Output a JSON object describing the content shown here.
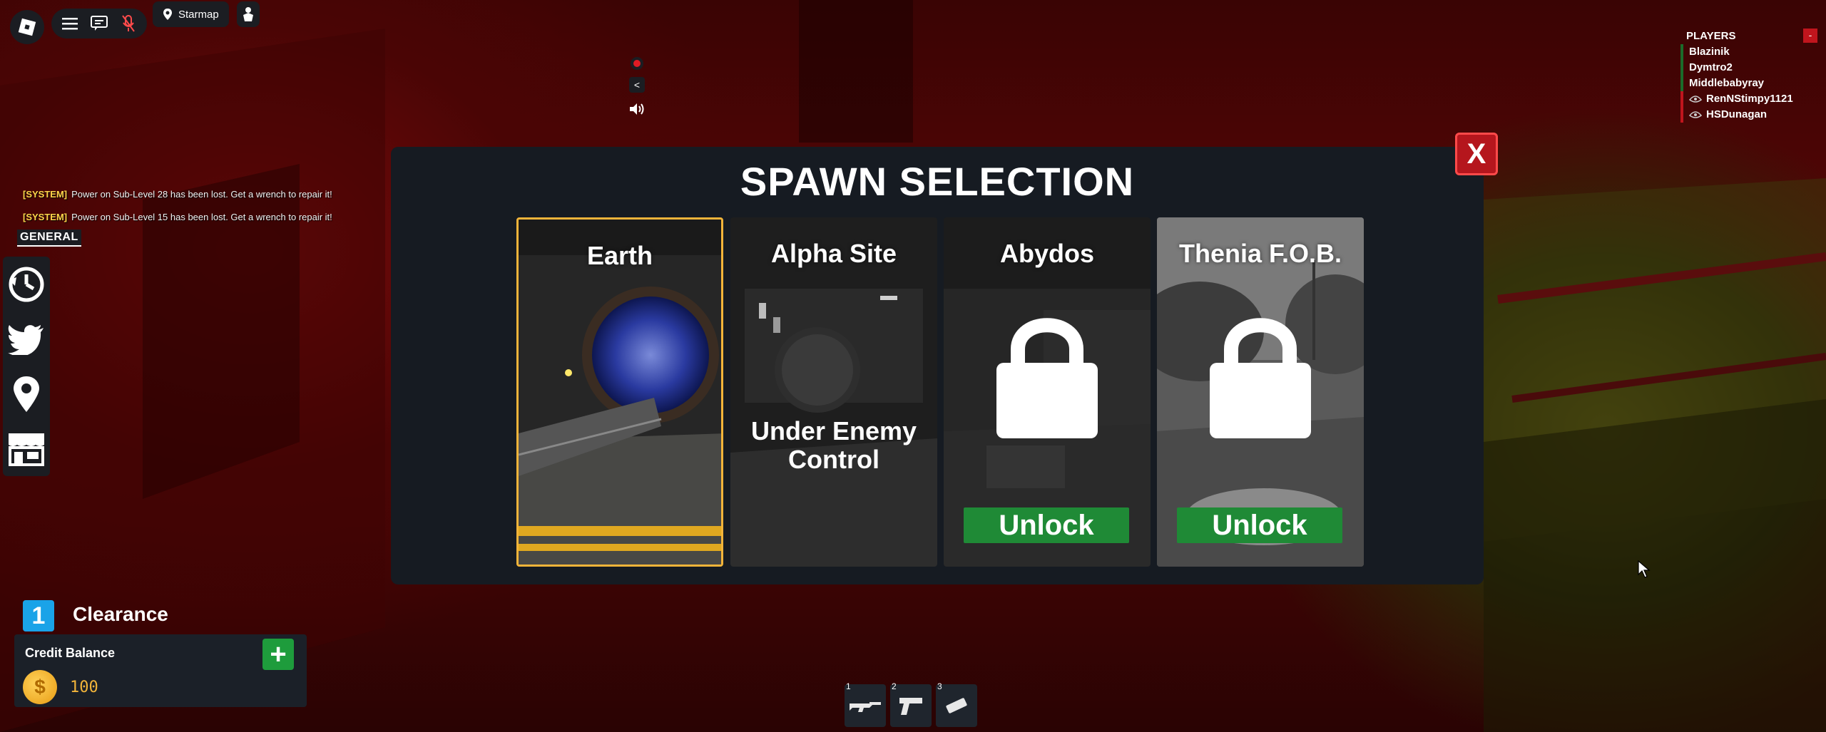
{
  "topbar": {
    "location_label": "Starmap"
  },
  "chat": {
    "messages": [
      {
        "tag": "[SYSTEM]",
        "text": "Power on Sub-Level 28 has been lost. Get a wrench to repair it!"
      },
      {
        "tag": "[SYSTEM]",
        "text": "Power on Sub-Level 15 has been lost. Get a wrench to repair it!"
      }
    ],
    "channel_tab": "GENERAL"
  },
  "mini_controls": {
    "collapse_label": "<"
  },
  "players": {
    "header": "PLAYERS",
    "close_label": "-",
    "list": [
      {
        "name": "Blazinik"
      },
      {
        "name": "Dymtro2"
      },
      {
        "name": "Middlebabyray"
      },
      {
        "name": "RenNStimpy1121"
      },
      {
        "name": "HSDunagan"
      }
    ]
  },
  "spawn": {
    "title": "SPAWN SELECTION",
    "close_label": "X",
    "cards": [
      {
        "name": "Earth",
        "state": "selected"
      },
      {
        "name": "Alpha Site",
        "status_line1": "Under Enemy",
        "status_line2": "Control"
      },
      {
        "name": "Abydos",
        "state": "locked",
        "button": "Unlock"
      },
      {
        "name": "Thenia F.O.B.",
        "state": "locked",
        "button": "Unlock"
      }
    ]
  },
  "clearance": {
    "level": "1",
    "label": "Clearance"
  },
  "credits": {
    "title": "Credit Balance",
    "add_label": "+",
    "coin_symbol": "$",
    "amount": "100"
  },
  "hotbar": {
    "slots": [
      {
        "number": "1",
        "icon": "rifle-icon"
      },
      {
        "number": "2",
        "icon": "pistol-icon"
      },
      {
        "number": "3",
        "icon": "card-icon"
      }
    ]
  },
  "colors": {
    "accent_selected": "#f2b43a",
    "unlock_green": "#1f8a36",
    "close_red": "#b5161d",
    "clearance_blue": "#1aa3e8"
  }
}
